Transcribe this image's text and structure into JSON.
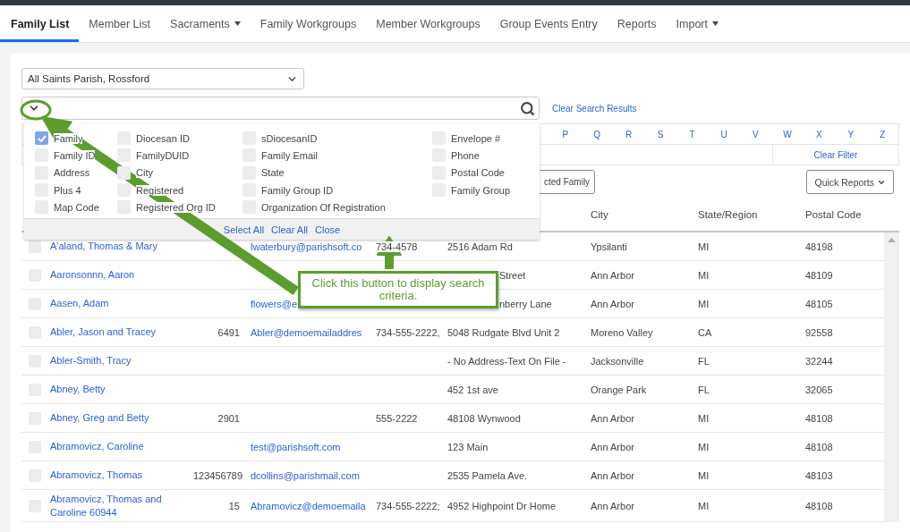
{
  "nav": {
    "tabs": [
      {
        "label": "Family List",
        "selected": true,
        "menu": false
      },
      {
        "label": "Member List",
        "selected": false,
        "menu": false
      },
      {
        "label": "Sacraments",
        "selected": false,
        "menu": true
      },
      {
        "label": "Family Workgroups",
        "selected": false,
        "menu": false
      },
      {
        "label": "Member Workgroups",
        "selected": false,
        "menu": false
      },
      {
        "label": "Group Events Entry",
        "selected": false,
        "menu": false
      },
      {
        "label": "Reports",
        "selected": false,
        "menu": false
      },
      {
        "label": "Import",
        "selected": false,
        "menu": true
      }
    ]
  },
  "parish_select": {
    "value": "All Saints Parish, Rossford"
  },
  "clear_search_link": "Clear Search Results",
  "search_criteria": {
    "open": true,
    "options": [
      {
        "label": "Family",
        "checked": true
      },
      {
        "label": "Diocesan ID",
        "checked": false
      },
      {
        "label": "sDiocesanID",
        "checked": false
      },
      {
        "label": "Envelope #",
        "checked": false
      },
      {
        "label": "Family ID",
        "checked": false
      },
      {
        "label": "FamilyDUID",
        "checked": false
      },
      {
        "label": "Family Email",
        "checked": false
      },
      {
        "label": "Phone",
        "checked": false
      },
      {
        "label": "Address",
        "checked": false
      },
      {
        "label": "City",
        "checked": false
      },
      {
        "label": "State",
        "checked": false
      },
      {
        "label": "Postal Code",
        "checked": false
      },
      {
        "label": "Plus 4",
        "checked": false
      },
      {
        "label": "Registered",
        "checked": false
      },
      {
        "label": "Family Group ID",
        "checked": false
      },
      {
        "label": "Family Group",
        "checked": false
      },
      {
        "label": "Map Code",
        "checked": false
      },
      {
        "label": "Registered Org ID",
        "checked": false
      },
      {
        "label": "Organization Of Registration",
        "checked": false
      }
    ],
    "actions": [
      "Select All",
      "Clear All",
      "Close"
    ]
  },
  "alphabet": [
    "P",
    "Q",
    "R",
    "S",
    "T",
    "U",
    "V",
    "W",
    "X",
    "Y",
    "Z"
  ],
  "clear_filter": "Clear Filter",
  "selected_family_button": "cted Family",
  "quick_reports_button": "Quick Reports",
  "table": {
    "columns": [
      "City",
      "State/Region",
      "Postal Code"
    ],
    "rows": [
      {
        "checked": false,
        "name": "A'aland, Thomas & Mary",
        "email": "lwaterbury@parishsoft.co",
        "phone": "734-4578",
        "phone_partly_covered": true,
        "address": "2516 Adam Rd",
        "city": "Ypsilanti",
        "state": "MI",
        "postal": "48198"
      },
      {
        "checked": false,
        "name": "Aaronsonnn, Aaron",
        "address": "Street",
        "address_partly_covered": true,
        "city": "Ann Arbor",
        "state": "MI",
        "postal": "48109"
      },
      {
        "checked": false,
        "name": "Aasen, Adam",
        "email": "flowers@e",
        "address": "nberry Lane",
        "address_partly_covered": true,
        "city": "Ann Arbor",
        "state": "MI",
        "postal": "48105"
      },
      {
        "checked": false,
        "name": "Abler, Jason and Tracey",
        "envelope": "6491",
        "email": "Abler@demoemailaddres",
        "phone": "734-555-2222,",
        "address": "5048 Rudgate Blvd Unit 2",
        "city": "Moreno Valley",
        "state": "CA",
        "postal": "92558"
      },
      {
        "checked": false,
        "name": "Abler-Smith, Tracy",
        "address": "- No Address-Text On File -",
        "city": "Jacksonville",
        "state": "FL",
        "postal": "32244"
      },
      {
        "checked": false,
        "name": "Abney, Betty",
        "address": "452 1st ave",
        "city": "Orange Park",
        "state": "FL",
        "postal": "32065"
      },
      {
        "checked": false,
        "name": "Abney, Greg and Betty",
        "envelope": "2901",
        "phone": "555-2222",
        "address": "48108 Wynwood",
        "city": "Ann Arbor",
        "state": "MI",
        "postal": "48108"
      },
      {
        "checked": false,
        "name": "Abramovicz, Caroline",
        "email": "test@parishsoft.com",
        "address": "123 Main",
        "city": "Ann Arbor",
        "state": "MI",
        "postal": "48108"
      },
      {
        "checked": false,
        "name": "Abramovicz, Thomas",
        "envelope": "123456789",
        "email": "dcollins@parishmail.com",
        "address": "2535 Pamela Ave.",
        "city": "Ann Arbor",
        "state": "MI",
        "postal": "48103"
      },
      {
        "checked": false,
        "name": "Abramovicz, Thomas and Caroline 60944",
        "envelope": "15",
        "email": "Abramovicz@demoemaila",
        "phone": "734-555-2222;",
        "address": "4952 Highpoint Dr Home",
        "city": "Ann Arbor",
        "state": "MI",
        "postal": "48108",
        "tall": true
      }
    ]
  },
  "callout": {
    "text": "Click this button to display search criteria."
  }
}
